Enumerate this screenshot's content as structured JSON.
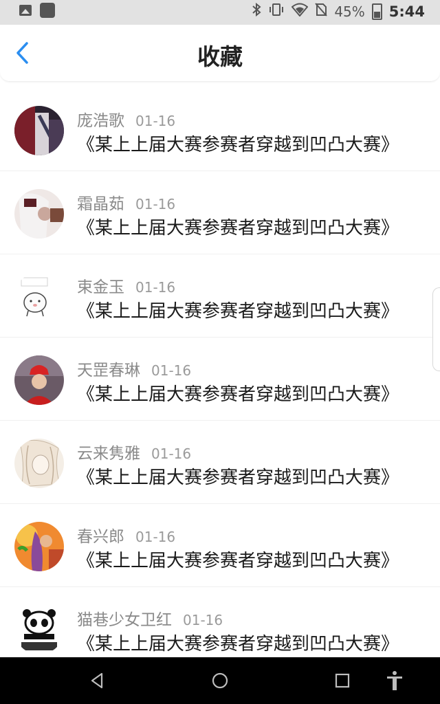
{
  "status_bar": {
    "battery_pct": "45%",
    "time": "5:44",
    "icons": [
      "image-icon",
      "app-icon",
      "bluetooth-icon",
      "vibrate-icon",
      "wifi-icon",
      "no-sim-icon",
      "battery-icon"
    ]
  },
  "header": {
    "title": "收藏",
    "back_icon": "chevron-left-icon"
  },
  "items": [
    {
      "name": "庞浩歌",
      "date": "01-16",
      "message": "《某上上届大赛参赛者穿越到凹凸大赛》"
    },
    {
      "name": "霜晶茹",
      "date": "01-16",
      "message": "《某上上届大赛参赛者穿越到凹凸大赛》"
    },
    {
      "name": "束金玉",
      "date": "01-16",
      "message": "《某上上届大赛参赛者穿越到凹凸大赛》"
    },
    {
      "name": "天罡春琳",
      "date": "01-16",
      "message": "《某上上届大赛参赛者穿越到凹凸大赛》"
    },
    {
      "name": "云来隽雅",
      "date": "01-16",
      "message": "《某上上届大赛参赛者穿越到凹凸大赛》"
    },
    {
      "name": "春兴郎",
      "date": "01-16",
      "message": "《某上上届大赛参赛者穿越到凹凸大赛》"
    },
    {
      "name": "猫巷少女卫红",
      "date": "01-16",
      "message": "《某上上届大赛参赛者穿越到凹凸大赛》"
    }
  ],
  "nav_bar": {
    "buttons": [
      "back-triangle-icon",
      "home-circle-icon",
      "recents-square-icon",
      "accessibility-icon"
    ]
  },
  "colors": {
    "accent": "#2b8ef0",
    "status_bar_bg": "#e2e2e2",
    "nav_bar_bg": "#000000"
  }
}
